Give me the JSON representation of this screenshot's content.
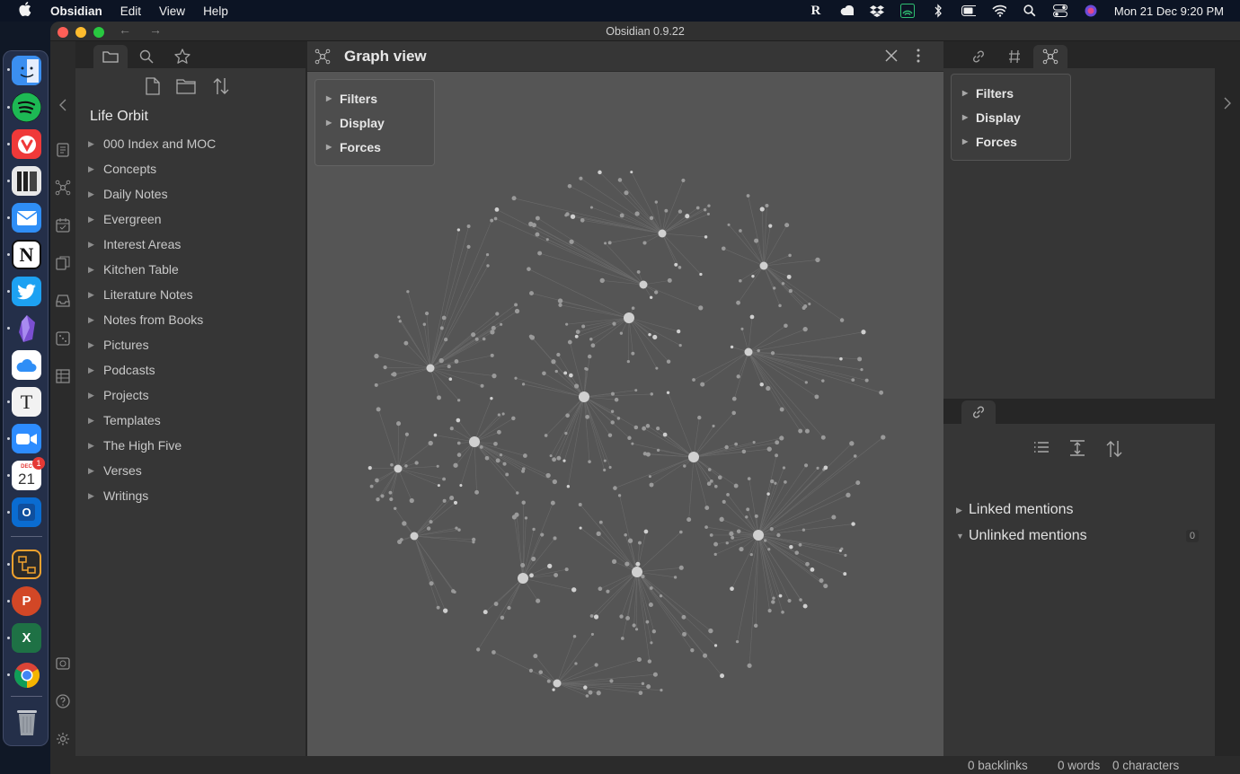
{
  "menubar": {
    "app": "Obsidian",
    "items": [
      "Edit",
      "View",
      "Help"
    ],
    "datetime": "Mon 21 Dec  9:20 PM",
    "reeder_letter": "R"
  },
  "window": {
    "title": "Obsidian 0.9.22"
  },
  "dock": {
    "apps": [
      {
        "name": "finder",
        "color": "#3b8ff0"
      },
      {
        "name": "spotify",
        "color": "#1db954"
      },
      {
        "name": "vivaldi",
        "color": "#ef3939"
      },
      {
        "name": "books-app",
        "color": "#e8e8e8"
      },
      {
        "name": "mail",
        "color": "#2f8ef6"
      },
      {
        "name": "notion",
        "color": "#ffffff"
      },
      {
        "name": "twitter",
        "color": "#1da1f2"
      },
      {
        "name": "obsidian",
        "color": "#7a4fd1"
      },
      {
        "name": "icloud-drive",
        "color": "#ffffff"
      },
      {
        "name": "typora",
        "color": "#f2f2f2"
      },
      {
        "name": "zoom",
        "color": "#2d8cff"
      },
      {
        "name": "calendar",
        "color": "#ffffff"
      },
      {
        "name": "outlook",
        "color": "#0a6cd1"
      },
      {
        "name": "app-diagram",
        "color": "#3a3a3a"
      },
      {
        "name": "powerpoint",
        "color": "#d24726"
      },
      {
        "name": "excel",
        "color": "#1e7145"
      },
      {
        "name": "chrome",
        "color": "#ffffff"
      },
      {
        "name": "trash",
        "color": "#9aa0a8"
      }
    ],
    "calendar_month": "DEC",
    "calendar_day": "21",
    "calendar_badge": "1",
    "notion_letter": "N",
    "typora_letter": "T",
    "outlook_letter": "O",
    "powerpoint_letter": "P",
    "excel_letter": "X"
  },
  "sidebar": {
    "vault_name": "Life Orbit",
    "folders": [
      "000 Index and MOC",
      "Concepts",
      "Daily Notes",
      "Evergreen",
      "Interest Areas",
      "Kitchen Table",
      "Literature Notes",
      "Notes from Books",
      "Pictures",
      "Podcasts",
      "Projects",
      "Templates",
      "The High Five",
      "Verses",
      "Writings"
    ]
  },
  "graph": {
    "title": "Graph view",
    "controls": [
      "Filters",
      "Display",
      "Forces"
    ]
  },
  "right_panel": {
    "local_graph_controls": [
      "Filters",
      "Display",
      "Forces"
    ],
    "linked_mentions": "Linked mentions",
    "unlinked_mentions": "Unlinked mentions",
    "unlinked_count": "0"
  },
  "status_bar": {
    "backlinks": "0 backlinks",
    "words": "0 words",
    "characters": "0 characters"
  }
}
